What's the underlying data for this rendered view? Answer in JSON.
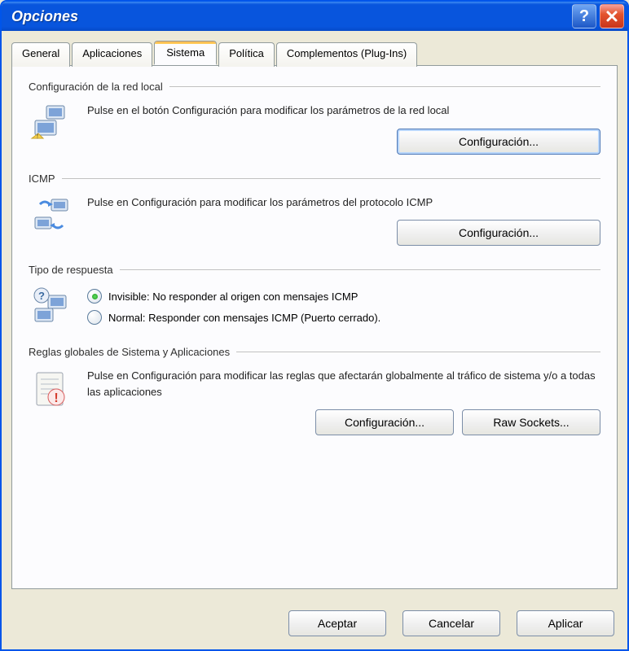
{
  "window": {
    "title": "Opciones"
  },
  "tabs": {
    "general": "General",
    "aplicaciones": "Aplicaciones",
    "sistema": "Sistema",
    "politica": "Política",
    "complementos": "Complementos (Plug-Ins)"
  },
  "groups": {
    "network": {
      "title": "Configuración de la red local",
      "desc": "Pulse en el botón Configuración para modificar los parámetros de la red local",
      "button": "Configuración..."
    },
    "icmp": {
      "title": "ICMP",
      "desc": "Pulse en Configuración para modificar los parámetros del protocolo ICMP",
      "button": "Configuración..."
    },
    "response": {
      "title": "Tipo de respuesta",
      "opt_invisible": "Invisible: No responder al origen con mensajes ICMP",
      "opt_normal": "Normal: Responder con mensajes ICMP (Puerto cerrado)."
    },
    "global": {
      "title": "Reglas globales de Sistema y Aplicaciones",
      "desc": "Pulse en Configuración para modificar las reglas que afectarán globalmente al tráfico de sistema y/o a todas las aplicaciones",
      "button_config": "Configuración...",
      "button_raw": "Raw Sockets..."
    }
  },
  "footer": {
    "accept": "Aceptar",
    "cancel": "Cancelar",
    "apply": "Aplicar"
  }
}
